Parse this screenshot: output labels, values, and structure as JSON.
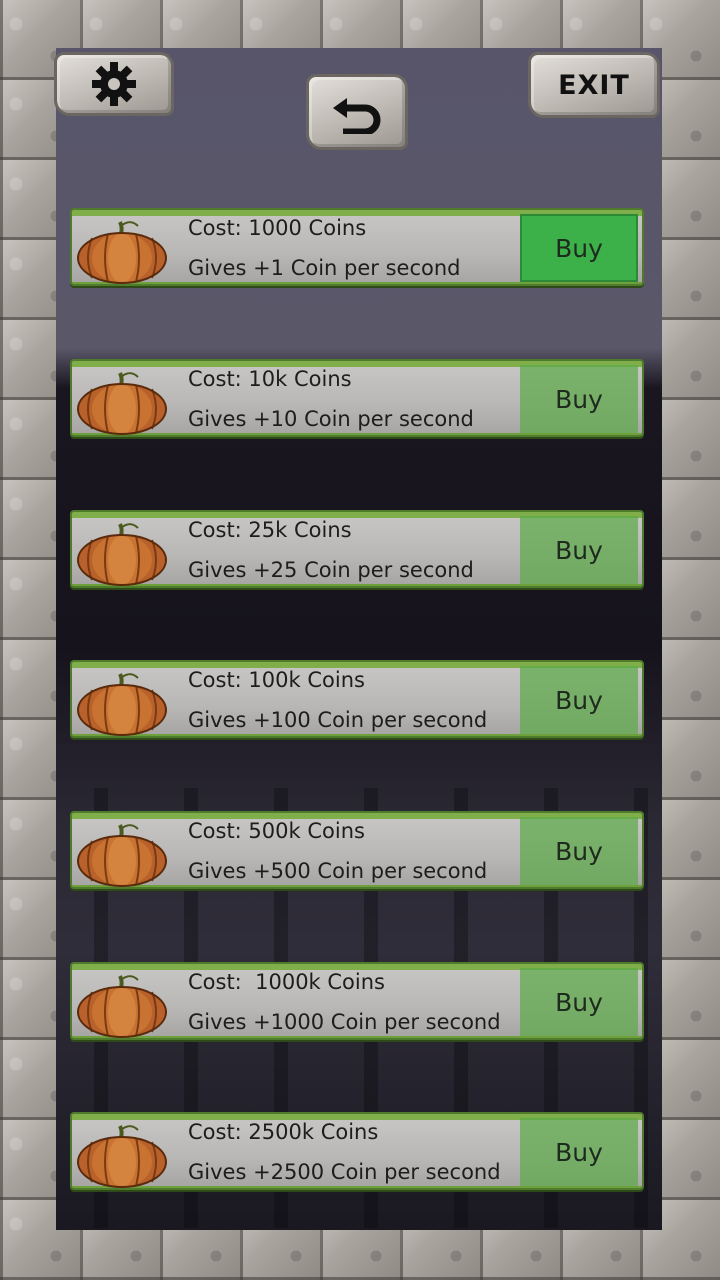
{
  "top_bar": {
    "exit_label": "EXIT"
  },
  "upgrades": [
    {
      "cost": "Cost: 1000 Coins",
      "gives": "Gives +1 Coin per second",
      "buy_label": "Buy",
      "affordable": true
    },
    {
      "cost": "Cost: 10k Coins",
      "gives": "Gives +10 Coin per second",
      "buy_label": "Buy",
      "affordable": false
    },
    {
      "cost": "Cost: 25k Coins",
      "gives": "Gives +25 Coin per second",
      "buy_label": "Buy",
      "affordable": false
    },
    {
      "cost": "Cost: 100k Coins",
      "gives": "Gives +100 Coin per second",
      "buy_label": "Buy",
      "affordable": false
    },
    {
      "cost": "Cost: 500k Coins",
      "gives": "Gives +500 Coin per second",
      "buy_label": "Buy",
      "affordable": false
    },
    {
      "cost": "Cost:  1000k Coins",
      "gives": "Gives +1000 Coin per second",
      "buy_label": "Buy",
      "affordable": false
    },
    {
      "cost": "Cost: 2500k Coins",
      "gives": "Gives +2500 Coin per second",
      "buy_label": "Buy",
      "affordable": false
    }
  ],
  "icons": {
    "settings": "gear-icon",
    "back": "undo-arrow-icon",
    "item": "pumpkin-icon"
  },
  "colors": {
    "buy_active": "#3cb049",
    "row_trim": "#6ea03c",
    "pumpkin": "#c06a2a"
  }
}
